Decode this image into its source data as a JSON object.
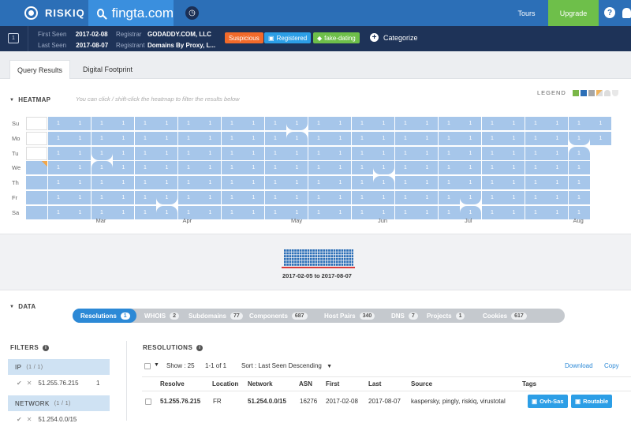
{
  "topbar": {
    "brand": "RISKIQ",
    "search_query": "fingta.com",
    "tours_label": "Tours",
    "upgrade_label": "Upgrade",
    "help_glyph": "?"
  },
  "infobar": {
    "first_seen_label": "First Seen",
    "first_seen_value": "2017-02-08",
    "last_seen_label": "Last Seen",
    "last_seen_value": "2017-08-07",
    "registrar_label": "Registrar",
    "registrar_value": "GODADDY.COM, LLC",
    "registrant_label": "Registrant",
    "registrant_value": "Domains By Proxy, L...",
    "tags": [
      {
        "label": "Suspicious",
        "color": "#f26a2a",
        "icon": ""
      },
      {
        "label": "Registered",
        "color": "#2c9ee6",
        "icon": "▣"
      },
      {
        "label": "fake-dating",
        "color": "#6ebf4a",
        "icon": "◆"
      }
    ],
    "categorize_label": "Categorize"
  },
  "tabs": [
    {
      "label": "Query Results",
      "active": true
    },
    {
      "label": "Digital Footprint",
      "active": false
    }
  ],
  "heatmap": {
    "title": "HEATMAP",
    "hint": "You can click / shift-click the heatmap to filter the results below",
    "legend_label": "LEGEND",
    "legend_colors": [
      "#7ab648",
      "#2c6fb7",
      "#a6a6a6",
      "#f0b35a",
      "#dddddd",
      "#e8e8e8"
    ],
    "days": [
      "Su",
      "Mo",
      "Tu",
      "We",
      "Th",
      "Fr",
      "Sa"
    ],
    "months": [
      {
        "label": "Mar",
        "week": 3
      },
      {
        "label": "Apr",
        "week": 7
      },
      {
        "label": "May",
        "week": 12
      },
      {
        "label": "Jun",
        "week": 16
      },
      {
        "label": "Jul",
        "week": 20
      },
      {
        "label": "Aug",
        "week": 25
      }
    ],
    "weeks": 27,
    "cell_value": "1"
  },
  "timeline": {
    "range_label": "2017-02-05 to 2017-08-07"
  },
  "data_section": {
    "title": "DATA",
    "pills": [
      {
        "label": "Resolutions",
        "count": "1",
        "active": true
      },
      {
        "label": "WHOIS",
        "count": "2"
      },
      {
        "label": "Subdomains",
        "count": "77"
      },
      {
        "label": "Components",
        "count": "687"
      },
      {
        "label": "Host Pairs",
        "count": "340"
      },
      {
        "label": "DNS",
        "count": "7"
      },
      {
        "label": "Projects",
        "count": "1"
      },
      {
        "label": "Cookies",
        "count": "617"
      }
    ]
  },
  "filters": {
    "title": "FILTERS",
    "groups": [
      {
        "label": "IP",
        "sub": "(1 / 1)",
        "item": "51.255.76.215",
        "count": "1"
      },
      {
        "label": "NETWORK",
        "sub": "(1 / 1)",
        "item": "51.254.0.0/15",
        "count": ""
      }
    ]
  },
  "resolutions": {
    "title": "RESOLUTIONS",
    "show_label": "Show : 25",
    "range_label": "1-1 of 1",
    "sort_label": "Sort : Last Seen Descending",
    "download_label": "Download",
    "copy_label": "Copy",
    "columns": [
      "Resolve",
      "Location",
      "Network",
      "ASN",
      "First",
      "Last",
      "Source",
      "Tags"
    ],
    "rows": [
      {
        "resolve": "51.255.76.215",
        "location": "FR",
        "network": "51.254.0.0/15",
        "asn": "16276",
        "first": "2017-02-08",
        "last": "2017-08-07",
        "source": "kaspersky, pingly, riskiq, virustotal",
        "tags": [
          "Ovh-Sas",
          "Routable"
        ]
      }
    ]
  }
}
